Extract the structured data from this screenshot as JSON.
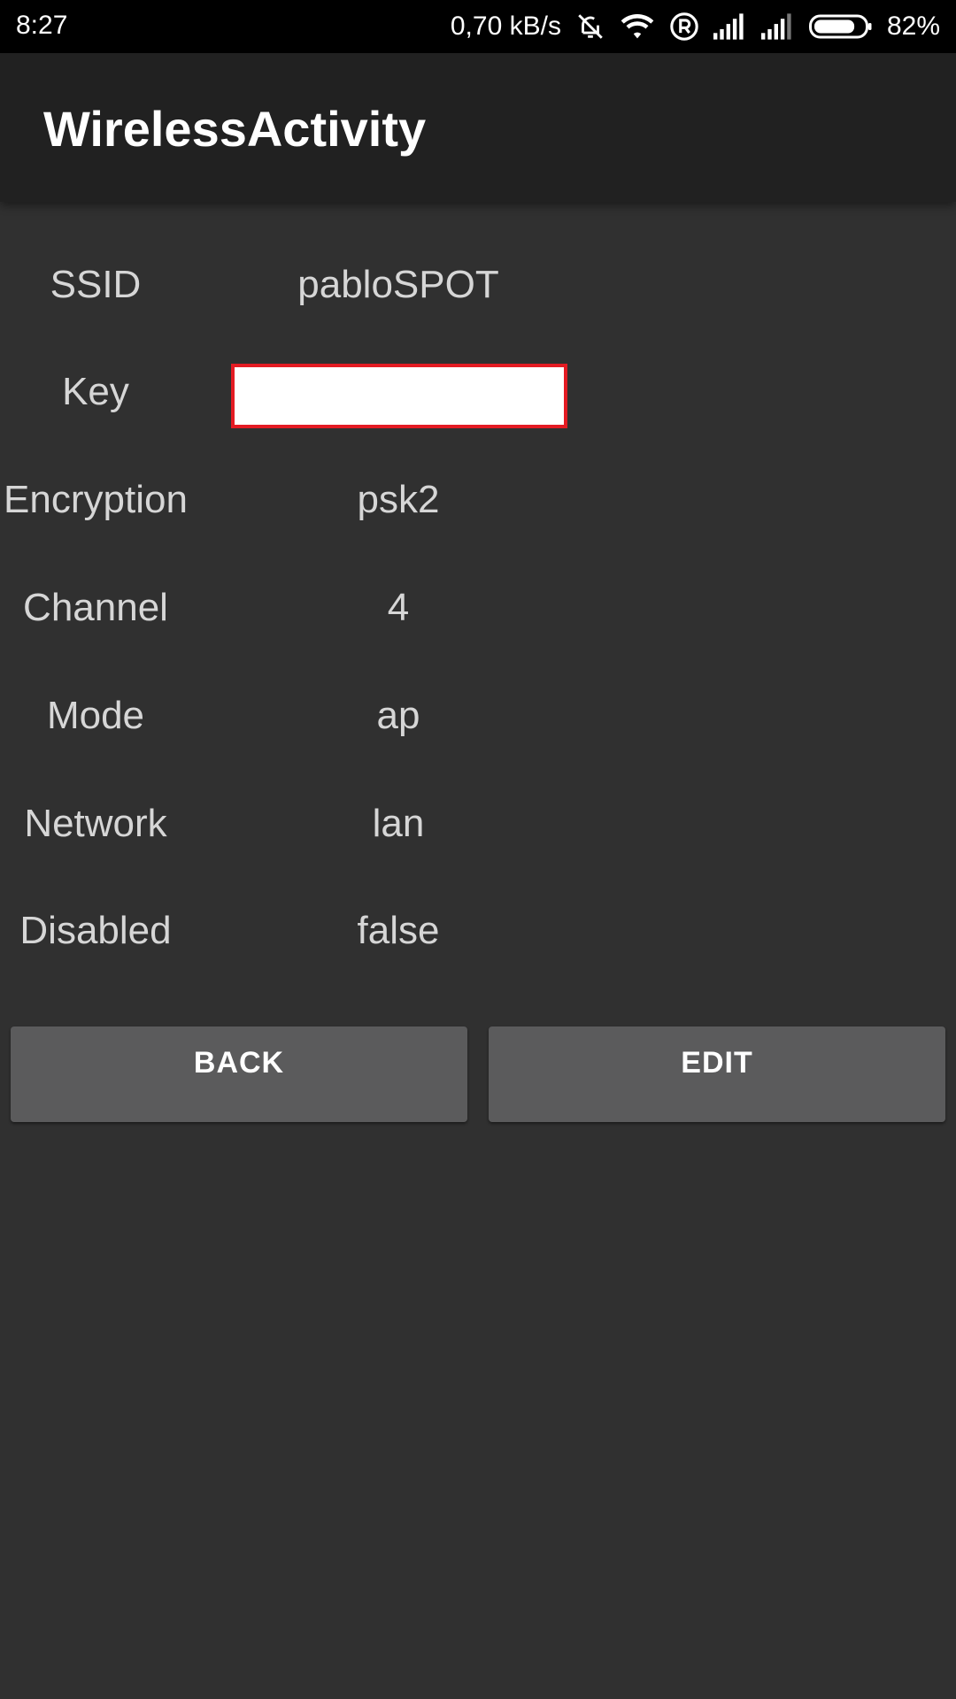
{
  "status_bar": {
    "time": "8:27",
    "speed": "0,70 kB/s",
    "battery": "82%",
    "battery_level": 0.82,
    "icons": [
      "notifications-off-icon",
      "wifi-icon",
      "roaming-r-icon",
      "signal-icon",
      "signal-icon",
      "battery-icon"
    ]
  },
  "app_bar": {
    "title": "WirelessActivity"
  },
  "fields": {
    "ssid": {
      "label": "SSID",
      "value": "pabloSPOT"
    },
    "key": {
      "label": "Key",
      "value": ""
    },
    "encryption": {
      "label": "Encryption",
      "value": "psk2"
    },
    "channel": {
      "label": "Channel",
      "value": "4"
    },
    "mode": {
      "label": "Mode",
      "value": "ap"
    },
    "network": {
      "label": "Network",
      "value": "lan"
    },
    "disabled": {
      "label": "Disabled",
      "value": "false"
    }
  },
  "buttons": {
    "back": "BACK",
    "edit": "EDIT"
  },
  "colors": {
    "background": "#303030",
    "app_bar": "#212121",
    "status_bar": "#000000",
    "button": "#5b5b5c",
    "key_border": "#e31b23",
    "text": "#d6d6d6"
  }
}
